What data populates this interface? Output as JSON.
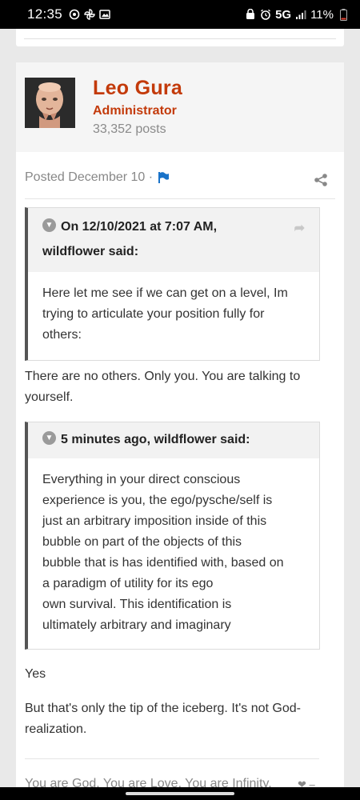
{
  "status": {
    "time": "12:35",
    "network": "5G",
    "battery": "11%"
  },
  "author": {
    "name": "Leo Gura",
    "role": "Administrator",
    "posts": "33,352 posts"
  },
  "post": {
    "posted": "Posted December 10 ·",
    "quote1": {
      "header_line1": "On 12/10/2021 at 7:07 AM,",
      "header_line2": "wildflower said:",
      "body": "Here let me see if we can get on a level, Im trying to articulate your position fully for others:"
    },
    "reply1": "There are no others. Only you. You are talking to yourself.",
    "quote2": {
      "header": "5 minutes ago, wildflower said:",
      "body_lines": [
        "Everything in your direct conscious",
        "experience is you, the ego/pysche/self is",
        "just an arbitrary imposition inside of this",
        "bubble on part of the objects of this",
        "bubble that is has identified with, based on",
        "a paradigm of utility for its ego",
        "own survival. This identification is",
        "ultimately arbitrary and imaginary"
      ]
    },
    "reply2": "Yes",
    "reply3": "But that's only the tip of the iceberg. It's not God-realization.",
    "signature": "You are God. You are Love. You are Infinity."
  },
  "icons": {
    "flag": "flag-icon",
    "share": "share-icon",
    "chevron": "chevron-down-icon",
    "goto": "go-to-quote-icon"
  },
  "colors": {
    "accent": "#c33a0a",
    "flag": "#1a73c9"
  }
}
